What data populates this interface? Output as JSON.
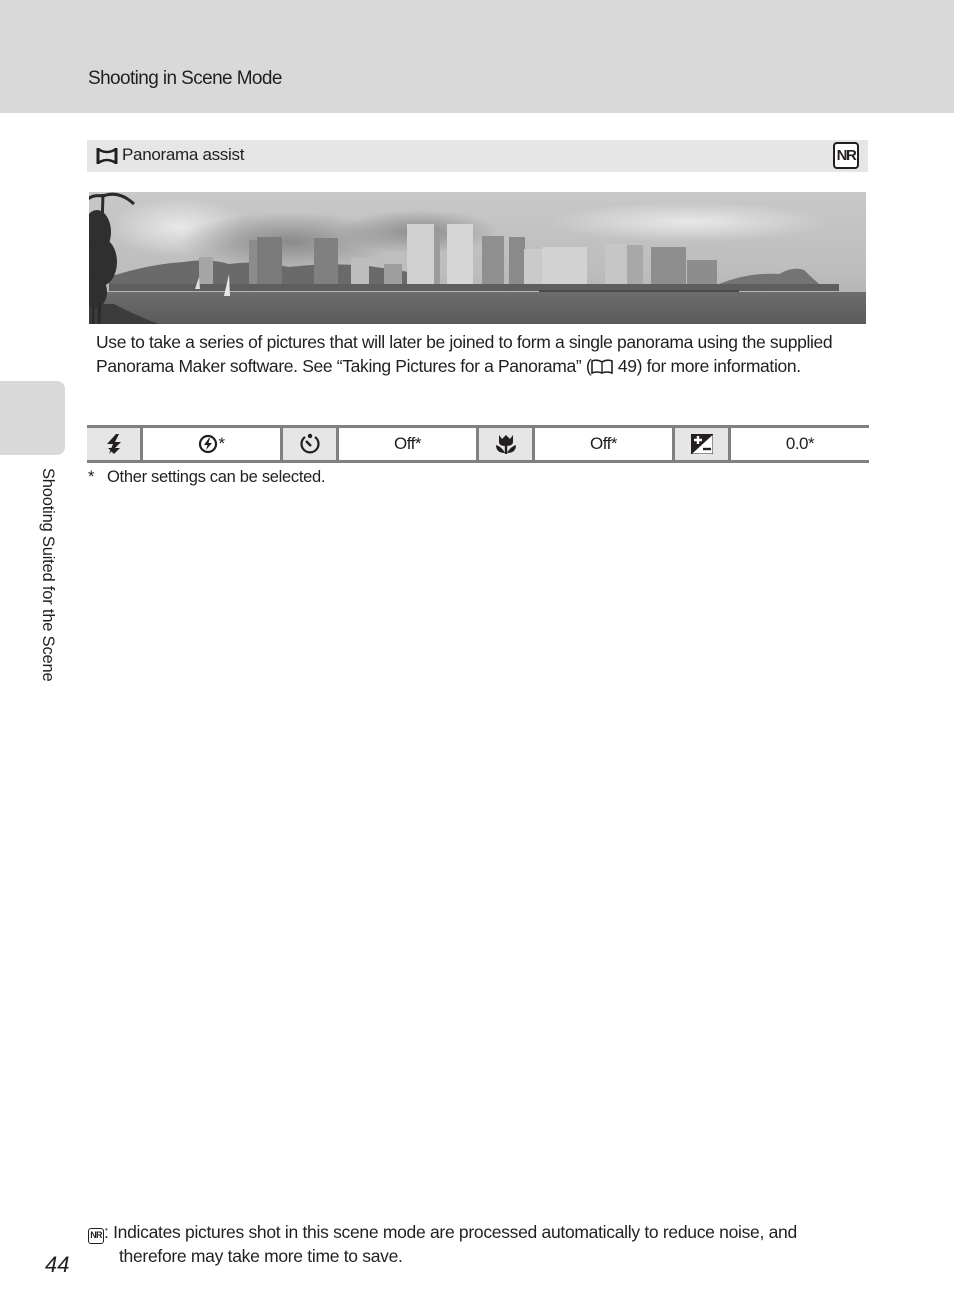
{
  "header": {
    "title": "Shooting in Scene Mode"
  },
  "section": {
    "icon": "panorama-assist-icon",
    "title": "Panorama assist",
    "badge": "NR"
  },
  "photo": {
    "description": "Black-and-white panoramic photograph of a city skyline with high-rise buildings across a harbor, palm trees on the left and a mountain (crater) on the right"
  },
  "description": {
    "text_before_ref": "Use to take a series of pictures that will later be joined to form a single panorama using the supplied Panorama Maker software. See “Taking Pictures for a Panorama” (",
    "ref_icon": "book-icon",
    "text_after_ref": " 49) for more information."
  },
  "settings_table": {
    "cells": [
      {
        "icon": "flash-mode-icon",
        "value_icon": "flash-off-icon",
        "value": "*"
      },
      {
        "icon": "self-timer-icon",
        "value": "Off*"
      },
      {
        "icon": "macro-mode-icon",
        "value": "Off*"
      },
      {
        "icon": "exposure-compensation-icon",
        "value": "0.0*"
      }
    ]
  },
  "footnote": {
    "marker": "*",
    "text": "Other settings can be selected."
  },
  "side_tab": {
    "label": "Shooting Suited for the Scene"
  },
  "bottom_note": {
    "badge": "NR",
    "line1": ": Indicates pictures shot in this scene mode are processed automatically to reduce noise, and",
    "line2": "therefore may take more time to save."
  },
  "page_number": "44"
}
